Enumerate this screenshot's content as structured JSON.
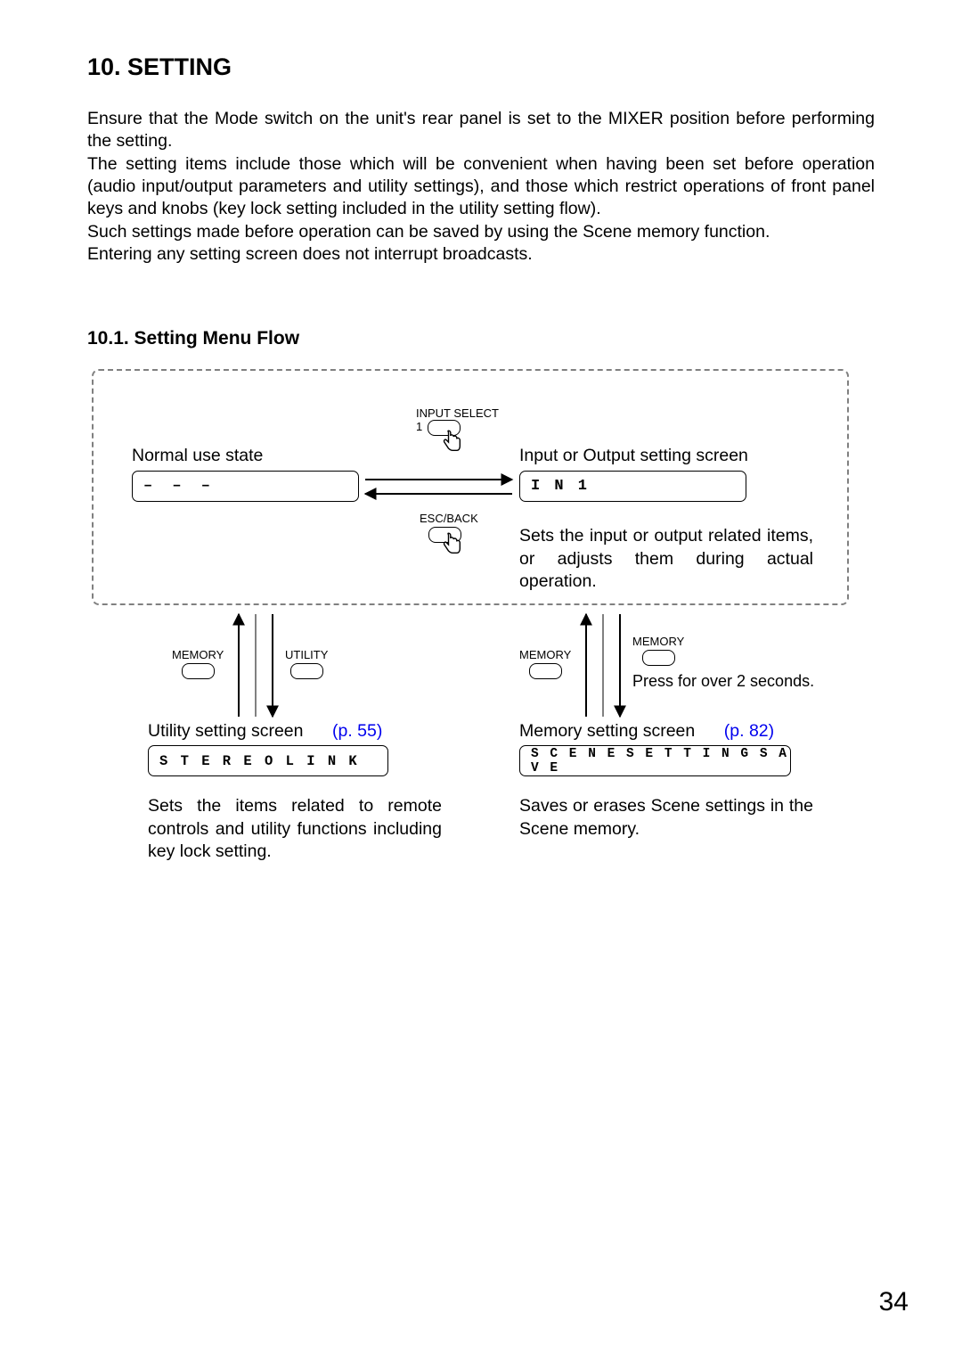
{
  "heading": "10. SETTING",
  "intro_p1": "Ensure that the Mode switch on the unit's rear panel is set to the MIXER position before performing the setting.",
  "intro_p2": "The setting items include those which will be convenient when having been set before operation (audio input/output parameters and utility settings), and those which restrict operations of front panel keys and knobs (key lock setting included in the utility setting flow).",
  "intro_p3": "Such settings made before operation can be saved by using the Scene memory function.",
  "intro_p4": "Entering any setting screen does not interrupt broadcasts.",
  "subheading": "10.1. Setting Menu Flow",
  "diagram": {
    "normal_label": "Normal use state",
    "normal_lcd": "– – –",
    "input_select_label": "INPUT SELECT",
    "input_select_num": "1",
    "esc_back_label": "ESC/BACK",
    "io_label": "Input or Output setting screen",
    "io_lcd": "I N 1",
    "io_desc": "Sets the input or output related items, or adjusts them during actual operation.",
    "memory_btn": "MEMORY",
    "utility_btn": "UTILITY",
    "press_note": "Press for over 2 seconds.",
    "utility_label": "Utility setting screen",
    "utility_ref": "(p. 55)",
    "utility_lcd": "S T E R E O    L I N K",
    "utility_desc": "Sets the items related to remote controls and utility functions including key lock setting.",
    "memory_label": "Memory setting screen",
    "memory_ref": "(p. 82)",
    "memory_lcd": "S C E N E S E T T I N G    S A V E",
    "memory_desc": "Saves or erases Scene settings in the Scene memory."
  },
  "page_number": "34"
}
